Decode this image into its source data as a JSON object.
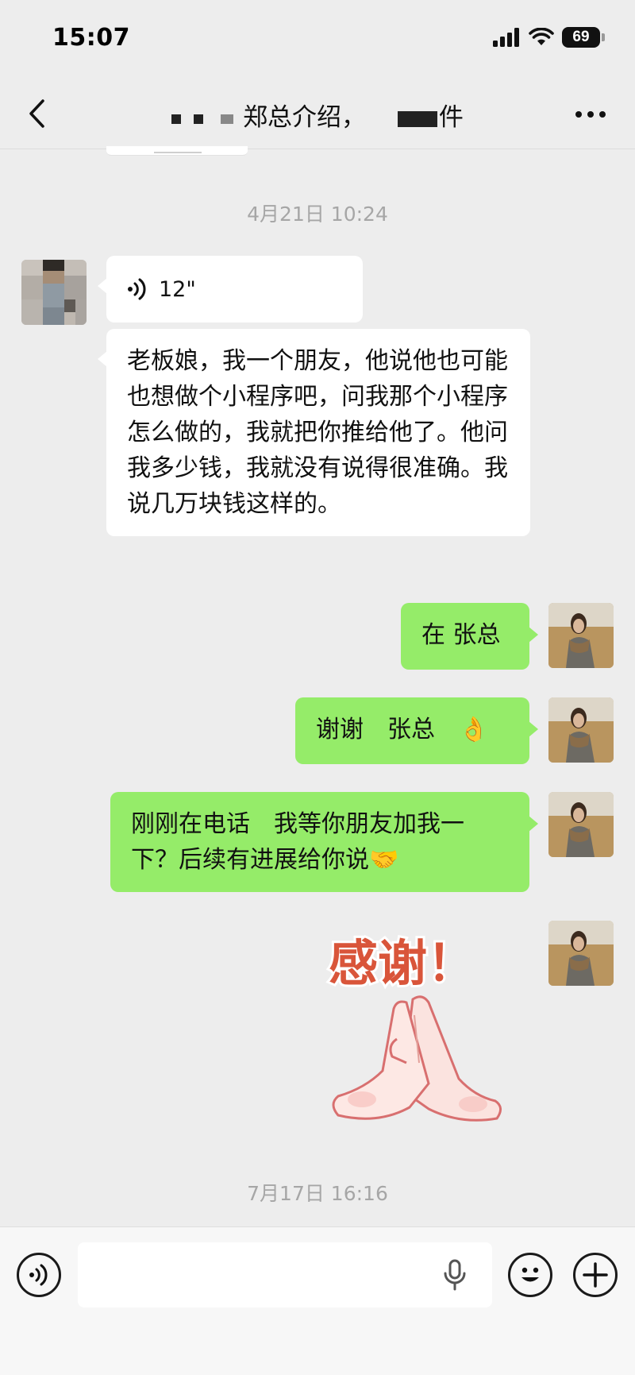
{
  "status_bar": {
    "time": "15:07",
    "battery": "69"
  },
  "chat": {
    "title": "郑总介绍，",
    "title_suffix": "件"
  },
  "messages": [
    {
      "type": "timestamp",
      "text": "4月21日 10:24"
    },
    {
      "type": "voice",
      "side": "in",
      "duration": "12\""
    },
    {
      "type": "text",
      "side": "in",
      "text": "老板娘，我一个朋友，他说他也可能也想做个小程序吧，问我那个小程序怎么做的，我就把你推给他了。他问我多少钱，我就没有说得很准确。我说几万块钱这样的。"
    },
    {
      "type": "text",
      "side": "out",
      "text": "在 张总"
    },
    {
      "type": "text",
      "side": "out",
      "text": "谢谢　张总　👌"
    },
    {
      "type": "text",
      "side": "out",
      "text": "刚刚在电话　我等你朋友加我一下？后续有进展给你说🤝"
    },
    {
      "type": "sticker",
      "side": "out",
      "text": "感谢！"
    },
    {
      "type": "timestamp",
      "text": "7月17日 16:16"
    }
  ],
  "input": {
    "placeholder": ""
  },
  "colors": {
    "background": "#ededed",
    "outgoing_bubble": "#95ec69",
    "incoming_bubble": "#ffffff",
    "timestamp": "#a6a6a6"
  },
  "icons": [
    "signal-icon",
    "wifi-icon",
    "battery-icon",
    "back-arrow-icon",
    "more-icon",
    "voice-wave-icon",
    "voice-input-icon",
    "microphone-icon",
    "emoji-icon",
    "plus-icon"
  ]
}
